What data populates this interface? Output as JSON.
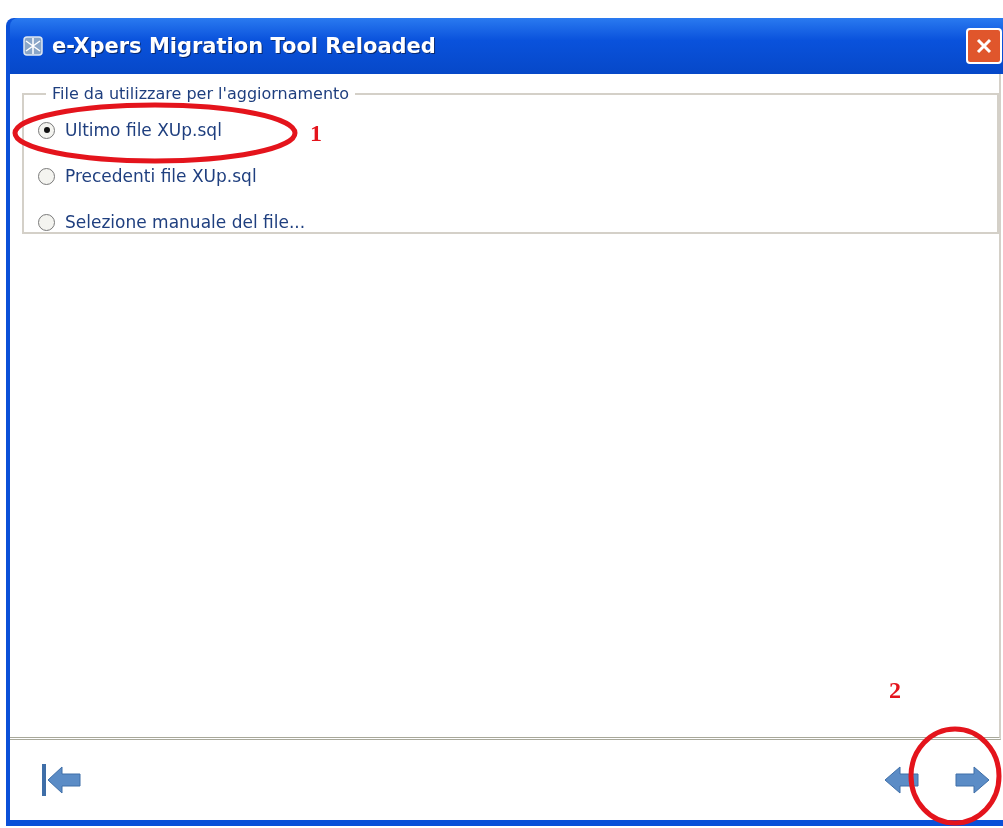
{
  "window": {
    "title": "e-Xpers Migration Tool Reloaded"
  },
  "group": {
    "title": "File da utilizzare per l'aggiornamento",
    "options": [
      {
        "label": "Ultimo file XUp.sql",
        "selected": true
      },
      {
        "label": "Precedenti file XUp.sql",
        "selected": false
      },
      {
        "label": "Selezione manuale del file...",
        "selected": false
      }
    ]
  },
  "annotations": [
    {
      "label": "1"
    },
    {
      "label": "2"
    }
  ]
}
